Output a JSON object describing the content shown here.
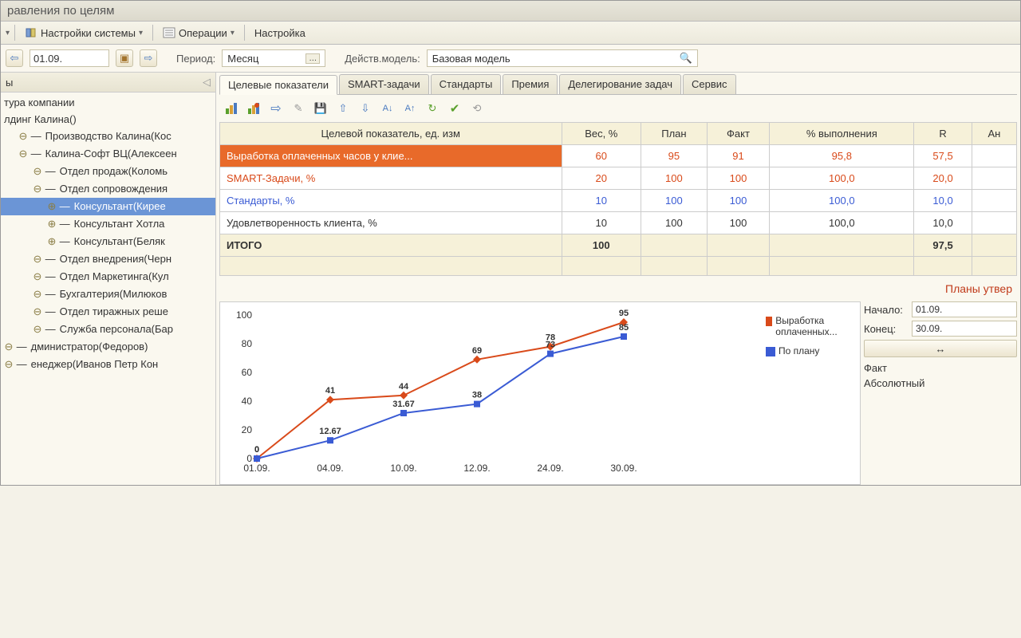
{
  "title": "равления по целям",
  "menu": {
    "settings": "Настройки системы",
    "ops": "Операции",
    "config": "Настройка"
  },
  "nav": {
    "date": "01.09.",
    "period_lbl": "Период:",
    "period_val": "Месяц",
    "model_lbl": "Действ.модель:",
    "model_val": "Базовая модель"
  },
  "side_head": "ы",
  "tree": [
    "тура компании",
    "лдинг Калина()",
    "Производство Калина(Кос",
    "Калина-Софт ВЦ(Алексеен",
    "Отдел продаж(Коломь",
    "Отдел сопровождения",
    "Консультант(Кирее",
    "Консультант Хотла",
    "Консультант(Беляк",
    "Отдел внедрения(Черн",
    "Отдел Маркетинга(Кул",
    "Бухгалтерия(Милюков",
    "Отдел тиражных реше",
    "Служба персонала(Бар",
    "дминистратор(Федоров)",
    "енеджер(Иванов Петр Кон"
  ],
  "tabs": [
    "Целевые показатели",
    "SMART-задачи",
    "Стандарты",
    "Премия",
    "Делегирование задач",
    "Сервис"
  ],
  "cols": [
    "Целевой показатель, ед. изм",
    "Вес, %",
    "План",
    "Факт",
    "% выполнения",
    "R",
    "Ан"
  ],
  "rows": [
    {
      "name": "Выработка оплаченных часов у клие...",
      "weight": "60",
      "plan": "95",
      "fact": "91",
      "pct": "95,8",
      "r": "57,5",
      "t": "o"
    },
    {
      "name": "SMART-Задачи, %",
      "weight": "20",
      "plan": "100",
      "fact": "100",
      "pct": "100,0",
      "r": "20,0",
      "t": "o2"
    },
    {
      "name": "Стандарты, %",
      "weight": "10",
      "plan": "100",
      "fact": "100",
      "pct": "100,0",
      "r": "10,0",
      "t": "b"
    },
    {
      "name": "Удовлетворенность клиента, %",
      "weight": "10",
      "plan": "100",
      "fact": "100",
      "pct": "100,0",
      "r": "10,0",
      "t": "n"
    }
  ],
  "total": {
    "label": "ИТОГО",
    "weight": "100",
    "r": "97,5"
  },
  "status": "Планы утвер",
  "legend": {
    "s1": "Выработка оплаченных...",
    "s2": "По плану"
  },
  "rp": {
    "start_lbl": "Начало:",
    "start": "01.09.",
    "end_lbl": "Конец:",
    "end": "30.09.",
    "opt1": "Факт",
    "opt2": "Абсолютный"
  },
  "chart_data": {
    "type": "line",
    "x": [
      "01.09.",
      "04.09.",
      "10.09.",
      "12.09.",
      "24.09.",
      "30.09."
    ],
    "series": [
      {
        "name": "Выработка оплаченных",
        "values": [
          0,
          41,
          44,
          69,
          78,
          95
        ],
        "color": "#d94a1a"
      },
      {
        "name": "По плану",
        "values": [
          0,
          12.67,
          31.67,
          38,
          73,
          85
        ],
        "color": "#3a5bd4"
      }
    ],
    "ylim": [
      0,
      100
    ],
    "yticks": [
      0,
      20,
      40,
      60,
      80,
      100
    ]
  }
}
